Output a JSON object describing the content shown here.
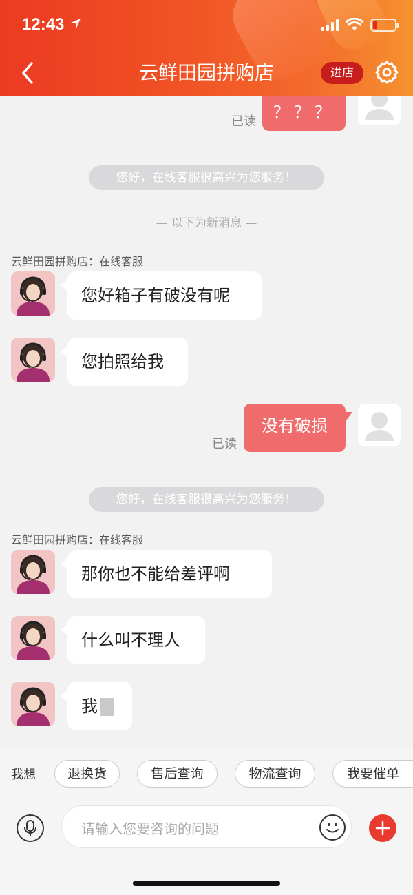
{
  "status_bar": {
    "time": "12:43"
  },
  "nav": {
    "title": "云鲜田园拼购店",
    "enter_store": "进店"
  },
  "colors": {
    "brand": "#ec3a22",
    "bubble_out": "#f06b6b",
    "plus": "#e83a2e"
  },
  "chat": {
    "top_partial_bubble": {
      "text": "？？？",
      "read": "已读"
    },
    "system_greeting": "您好，在线客服很高兴为您服务！",
    "new_divider": "— 以下为新消息 —",
    "group1": {
      "sender": "云鲜田园拼购店：在线客服",
      "messages": [
        "您好箱子有破没有呢",
        "您拍照给我"
      ]
    },
    "outgoing": {
      "text": "没有破损",
      "read": "已读"
    },
    "group2": {
      "sender": "云鲜田园拼购店：在线客服",
      "messages": [
        "那你也不能给差评啊",
        "什么叫不理人",
        "我"
      ]
    }
  },
  "quick": {
    "label": "我想",
    "chips": [
      "退换货",
      "售后查询",
      "物流查询",
      "我要催单"
    ]
  },
  "input": {
    "placeholder": "请输入您要咨询的问题"
  }
}
